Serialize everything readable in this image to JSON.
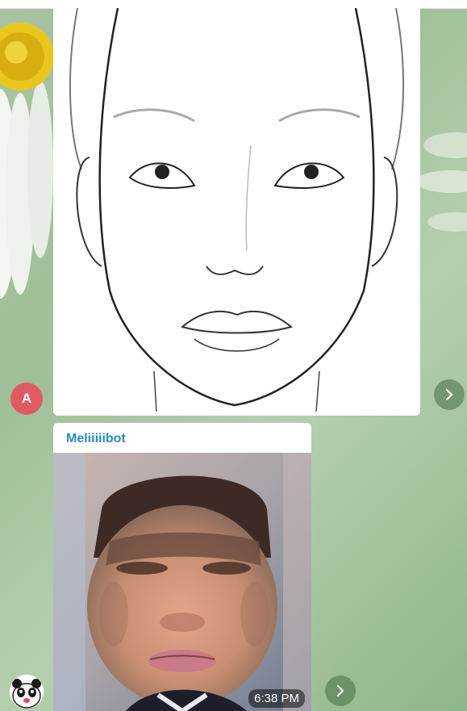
{
  "chat": {
    "messages": [
      {
        "sender_initial": "A",
        "type": "photo",
        "image_desc": "face-sketch"
      },
      {
        "sender_name": "Meliiiiibot",
        "type": "photo",
        "time": "6:38 PM",
        "image_desc": "generated-face"
      }
    ]
  },
  "colors": {
    "avatar_a": "#e05a63",
    "sender_name": "#2a8bbd",
    "forward_button": "#466e46"
  },
  "icons": {
    "forward": "chevron-right-icon",
    "bot_avatar": "panda-avatar-icon"
  }
}
